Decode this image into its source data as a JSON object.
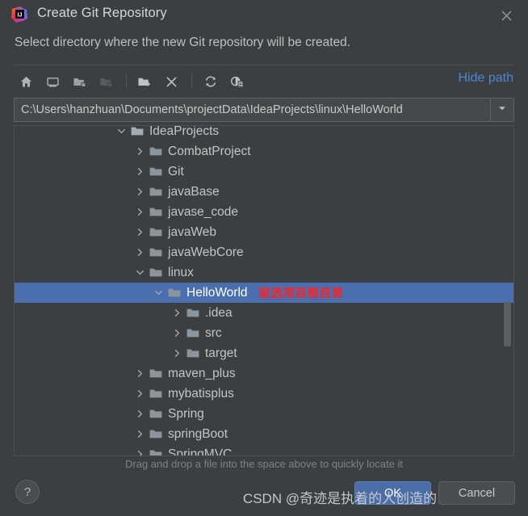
{
  "window": {
    "title": "Create Git Repository",
    "icon": "intellij-idea-logo",
    "close_label": "×"
  },
  "subtitle": "Select directory where the new Git repository will be created.",
  "toolbar": {
    "buttons": [
      {
        "name": "home-icon",
        "tooltip": "Home",
        "disabled": false
      },
      {
        "name": "desktop-icon",
        "tooltip": "Desktop",
        "disabled": false
      },
      {
        "name": "expand-folder-icon",
        "tooltip": "Expand All",
        "disabled": false
      },
      {
        "name": "collapse-folder-icon",
        "tooltip": "Collapse All",
        "disabled": true
      },
      {
        "name": "new-folder-icon",
        "tooltip": "New Folder",
        "disabled": false
      },
      {
        "name": "delete-icon",
        "tooltip": "Delete",
        "disabled": false
      },
      {
        "name": "refresh-icon",
        "tooltip": "Refresh",
        "disabled": false
      },
      {
        "name": "show-hidden-files-icon",
        "tooltip": "Show Hidden Files",
        "disabled": false
      }
    ],
    "hide_path_label": "Hide path"
  },
  "path_field": {
    "value": "C:\\Users\\hanzhuan\\Documents\\projectData\\IdeaProjects\\linux\\HelloWorld",
    "placeholder": "",
    "dropdown_icon": "chevron-down-icon"
  },
  "tree": {
    "rows": [
      {
        "label": "IdeaProjects",
        "indent": 0,
        "twisty": "expanded",
        "selected": false,
        "annotation": ""
      },
      {
        "label": "CombatProject",
        "indent": 1,
        "twisty": "collapsed",
        "selected": false,
        "annotation": ""
      },
      {
        "label": "Git",
        "indent": 1,
        "twisty": "collapsed",
        "selected": false,
        "annotation": ""
      },
      {
        "label": "javaBase",
        "indent": 1,
        "twisty": "collapsed",
        "selected": false,
        "annotation": ""
      },
      {
        "label": "javase_code",
        "indent": 1,
        "twisty": "collapsed",
        "selected": false,
        "annotation": ""
      },
      {
        "label": "javaWeb",
        "indent": 1,
        "twisty": "collapsed",
        "selected": false,
        "annotation": ""
      },
      {
        "label": "javaWebCore",
        "indent": 1,
        "twisty": "collapsed",
        "selected": false,
        "annotation": ""
      },
      {
        "label": "linux",
        "indent": 1,
        "twisty": "expanded",
        "selected": false,
        "annotation": ""
      },
      {
        "label": "HelloWorld",
        "indent": 2,
        "twisty": "expanded",
        "selected": true,
        "annotation": "就选项目根目录"
      },
      {
        "label": ".idea",
        "indent": 3,
        "twisty": "collapsed",
        "selected": false,
        "annotation": ""
      },
      {
        "label": "src",
        "indent": 3,
        "twisty": "collapsed",
        "selected": false,
        "annotation": ""
      },
      {
        "label": "target",
        "indent": 3,
        "twisty": "collapsed",
        "selected": false,
        "annotation": ""
      },
      {
        "label": "maven_plus",
        "indent": 1,
        "twisty": "collapsed",
        "selected": false,
        "annotation": ""
      },
      {
        "label": "mybatisplus",
        "indent": 1,
        "twisty": "collapsed",
        "selected": false,
        "annotation": ""
      },
      {
        "label": "Spring",
        "indent": 1,
        "twisty": "collapsed",
        "selected": false,
        "annotation": ""
      },
      {
        "label": "springBoot",
        "indent": 1,
        "twisty": "collapsed",
        "selected": false,
        "annotation": ""
      },
      {
        "label": "SpringMVC",
        "indent": 1,
        "twisty": "collapsed",
        "selected": false,
        "annotation": ""
      }
    ]
  },
  "hint": "Drag and drop a file into the space above to quickly locate it",
  "footer": {
    "help_label": "?",
    "ok_label": "OK",
    "cancel_label": "Cancel"
  },
  "watermark": "CSDN @奇迹是执着的人创造的",
  "colors": {
    "dialog_bg": "#3c3f41",
    "selection_blue": "#4b6eaf",
    "link_blue": "#4d86d4",
    "annotation_red": "#ff2020",
    "ok_button_blue": "#4a6da7",
    "folder_gray": "#8c949c",
    "text": "#c4c4c4"
  }
}
